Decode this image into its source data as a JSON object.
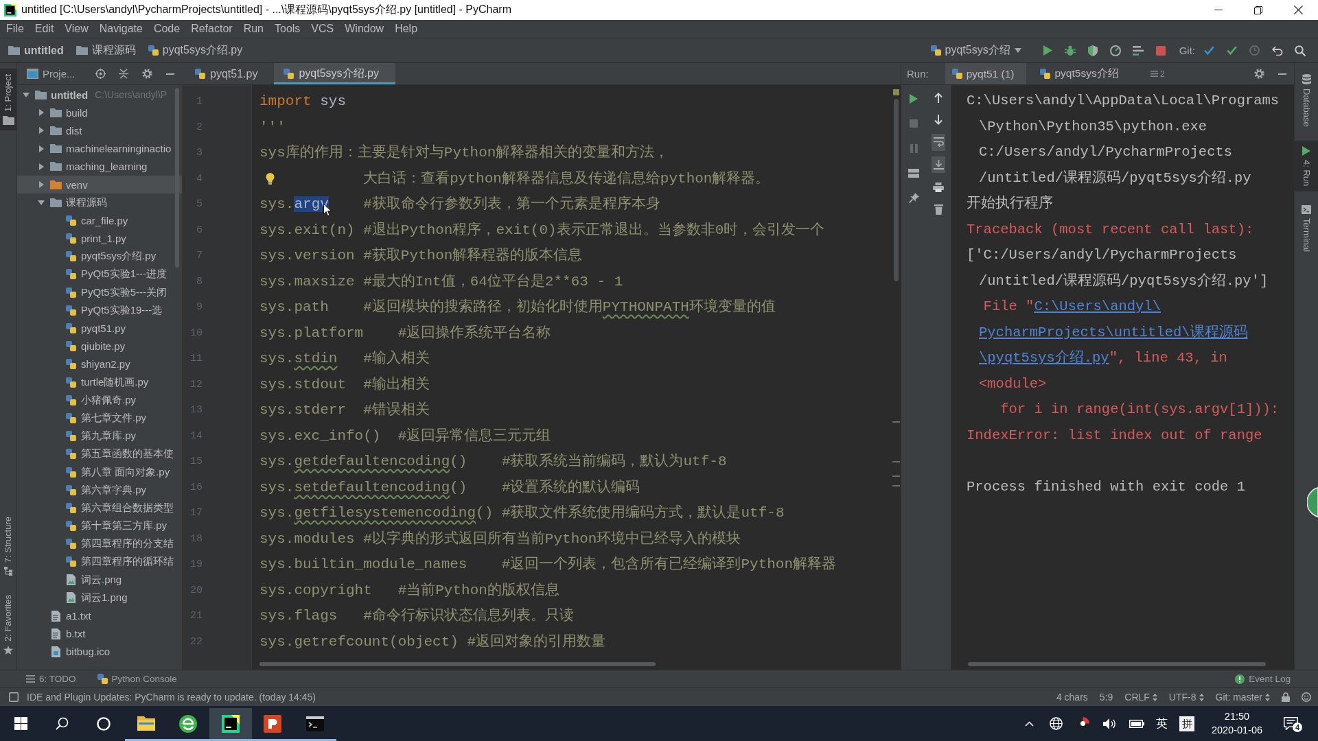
{
  "window": {
    "title": "untitled [C:\\Users\\andyl\\PycharmProjects\\untitled] - ...\\课程源码\\pyqt5sys介绍.py [untitled] - PyCharm"
  },
  "menu": [
    "File",
    "Edit",
    "View",
    "Navigate",
    "Code",
    "Refactor",
    "Run",
    "Tools",
    "VCS",
    "Window",
    "Help"
  ],
  "navigation": {
    "breadcrumbs": [
      {
        "kind": "module",
        "label": "untitled"
      },
      {
        "kind": "folder",
        "label": "课程源码"
      },
      {
        "kind": "python",
        "label": "pyqt5sys介绍.py"
      }
    ],
    "run_config": "pyqt5sys介绍",
    "actions": [
      {
        "kind": "run",
        "disabled": false
      },
      {
        "kind": "debug",
        "disabled": false
      },
      {
        "kind": "coverage",
        "disabled": false
      },
      {
        "kind": "profile",
        "disabled": false
      },
      {
        "kind": "concurrency",
        "disabled": false
      },
      {
        "kind": "stop",
        "disabled": false
      }
    ],
    "vcs": {
      "label": "Git:",
      "actions": [
        {
          "kind": "update",
          "disabled": false
        },
        {
          "kind": "commit",
          "disabled": false
        },
        {
          "kind": "history",
          "disabled": true
        },
        {
          "kind": "revert",
          "disabled": false
        }
      ]
    }
  },
  "left_tool_strip": {
    "top": [
      {
        "kind": "project",
        "label": "1: Project",
        "selected": true
      }
    ],
    "bottom": [
      {
        "kind": "structure",
        "label": "7: Structure",
        "selected": false
      },
      {
        "kind": "favorites",
        "label": "2: Favorites",
        "selected": false
      }
    ]
  },
  "project_panel": {
    "title": "Proje...",
    "tree": [
      {
        "kind": "module",
        "name": "untitled",
        "path": "C:\\Users\\andyl\\P",
        "expanded": true,
        "selected": false,
        "children": [
          {
            "kind": "folder",
            "name": "build",
            "expanded": false,
            "selected": false
          },
          {
            "kind": "folder",
            "name": "dist",
            "expanded": false,
            "selected": false
          },
          {
            "kind": "folder",
            "name": "machinelearninginactio",
            "expanded": false,
            "selected": false
          },
          {
            "kind": "folder",
            "name": "maching_learning",
            "expanded": false,
            "selected": false
          },
          {
            "kind": "excluded",
            "name": "venv",
            "expanded": false,
            "selected": true
          },
          {
            "kind": "folder",
            "name": "课程源码",
            "expanded": true,
            "selected": false,
            "children": [
              {
                "kind": "python",
                "name": "car_file.py",
                "selected": false
              },
              {
                "kind": "python",
                "name": "print_1.py",
                "selected": false
              },
              {
                "kind": "python",
                "name": "pyqt5sys介绍.py",
                "selected": false
              },
              {
                "kind": "python",
                "name": "PyQt5实验1---进度",
                "selected": false
              },
              {
                "kind": "python",
                "name": "PyQt5实验5---关闭",
                "selected": false
              },
              {
                "kind": "python",
                "name": "PyQt5实验19---选",
                "selected": false
              },
              {
                "kind": "python",
                "name": "pyqt51.py",
                "selected": false
              },
              {
                "kind": "python",
                "name": "qiubite.py",
                "selected": false
              },
              {
                "kind": "python",
                "name": "shiyan2.py",
                "selected": false
              },
              {
                "kind": "python",
                "name": "turtle随机画.py",
                "selected": false
              },
              {
                "kind": "python",
                "name": "小猪佩奇.py",
                "selected": false
              },
              {
                "kind": "python",
                "name": "第七章文件.py",
                "selected": false
              },
              {
                "kind": "python",
                "name": "第九章库.py",
                "selected": false
              },
              {
                "kind": "python",
                "name": "第五章函数的基本使",
                "selected": false
              },
              {
                "kind": "python",
                "name": "第八章 面向对象.py",
                "selected": false
              },
              {
                "kind": "python",
                "name": "第六章字典.py",
                "selected": false
              },
              {
                "kind": "python",
                "name": "第六章组合数据类型",
                "selected": false
              },
              {
                "kind": "python",
                "name": "第十章第三方库.py",
                "selected": false
              },
              {
                "kind": "python",
                "name": "第四章程序的分支结",
                "selected": false
              },
              {
                "kind": "python",
                "name": "第四章程序的循环结",
                "selected": false
              },
              {
                "kind": "image",
                "name": "词云.png",
                "selected": false
              },
              {
                "kind": "image",
                "name": "词云1.png",
                "selected": false
              }
            ]
          },
          {
            "kind": "text",
            "name": "a1.txt",
            "selected": false
          },
          {
            "kind": "text",
            "name": "b.txt",
            "selected": false
          },
          {
            "kind": "icon",
            "name": "bitbug.ico",
            "selected": false
          }
        ]
      }
    ]
  },
  "editor": {
    "tabs": [
      {
        "label": "pyqt51.py",
        "selected": false
      },
      {
        "label": "pyqt5sys介绍.py",
        "selected": true
      }
    ],
    "lines": [
      {
        "number": "1",
        "segments": [
          {
            "kind": "keyword",
            "text": "import"
          },
          {
            "kind": "name",
            "text": " sys"
          }
        ]
      },
      {
        "number": "2",
        "segments": [
          {
            "kind": "doc",
            "text": "'''"
          }
        ]
      },
      {
        "number": "3",
        "segments": [
          {
            "kind": "doc",
            "text": "sys库的作用：主要是针对与Python解释器相关的变量和方法，"
          }
        ]
      },
      {
        "number": "4",
        "bulb": true,
        "segments": [
          {
            "kind": "doc",
            "text": "            大白话：查看python解释器信息及传递信息给python解释器。"
          }
        ]
      },
      {
        "number": "5",
        "segments": [
          {
            "kind": "doc",
            "text": "sys."
          },
          {
            "kind": "selection",
            "text": "argv"
          },
          {
            "kind": "doc",
            "text": "    #获取命令行参数列表，第一个元素是程序本身"
          }
        ]
      },
      {
        "number": "6",
        "segments": [
          {
            "kind": "doc",
            "text": "sys.exit(n) #退出Python程序，exit(0)表示正常退出。当参数非0时，会引发一个"
          }
        ]
      },
      {
        "number": "7",
        "segments": [
          {
            "kind": "doc",
            "text": "sys.version #获取Python解释程器的版本信息"
          }
        ]
      },
      {
        "number": "8",
        "segments": [
          {
            "kind": "doc",
            "text": "sys.maxsize #最大的Int值，64位平台是2**63 - 1"
          }
        ]
      },
      {
        "number": "9",
        "segments": [
          {
            "kind": "doc",
            "text": "sys.path    #返回模块的搜索路径，初始化时使用"
          },
          {
            "kind": "typo",
            "text": "PYTHONPATH"
          },
          {
            "kind": "doc",
            "text": "环境变量的值"
          }
        ]
      },
      {
        "number": "10",
        "segments": [
          {
            "kind": "doc",
            "text": "sys.platform    #返回操作系统平台名称"
          }
        ]
      },
      {
        "number": "11",
        "segments": [
          {
            "kind": "doc",
            "text": "sys."
          },
          {
            "kind": "typo",
            "text": "stdin"
          },
          {
            "kind": "doc",
            "text": "   #输入相关"
          }
        ]
      },
      {
        "number": "12",
        "segments": [
          {
            "kind": "doc",
            "text": "sys.stdout  #输出相关"
          }
        ]
      },
      {
        "number": "13",
        "segments": [
          {
            "kind": "doc",
            "text": "sys.stderr  #错误相关"
          }
        ]
      },
      {
        "number": "14",
        "segments": [
          {
            "kind": "doc",
            "text": "sys.exc_info()  #返回异常信息三元元组"
          }
        ]
      },
      {
        "number": "15",
        "segments": [
          {
            "kind": "doc",
            "text": "sys."
          },
          {
            "kind": "typo",
            "text": "getdefaultencoding"
          },
          {
            "kind": "doc",
            "text": "()    #获取系统当前编码，默认为utf-8"
          }
        ]
      },
      {
        "number": "16",
        "segments": [
          {
            "kind": "doc",
            "text": "sys."
          },
          {
            "kind": "typo",
            "text": "setdefaultencoding"
          },
          {
            "kind": "doc",
            "text": "()    #设置系统的默认编码"
          }
        ]
      },
      {
        "number": "17",
        "segments": [
          {
            "kind": "doc",
            "text": "sys."
          },
          {
            "kind": "typo",
            "text": "getfilesystemencoding"
          },
          {
            "kind": "doc",
            "text": "() #获取文件系统使用编码方式，默认是utf-8"
          }
        ]
      },
      {
        "number": "18",
        "segments": [
          {
            "kind": "doc",
            "text": "sys.modules #以字典的形式返回所有当前Python环境中已经导入的模块"
          }
        ]
      },
      {
        "number": "19",
        "segments": [
          {
            "kind": "doc",
            "text": "sys.builtin_module_names    #返回一个列表，包含所有已经编译到Python解释器"
          }
        ]
      },
      {
        "number": "20",
        "segments": [
          {
            "kind": "doc",
            "text": "sys.copyright   #当前Python的版权信息"
          }
        ]
      },
      {
        "number": "21",
        "segments": [
          {
            "kind": "doc",
            "text": "sys.flags   #命令行标识状态信息列表。只读"
          }
        ]
      },
      {
        "number": "22",
        "segments": [
          {
            "kind": "doc",
            "text": "sys.getrefcount(object) #返回对象的引用数量"
          }
        ]
      }
    ]
  },
  "run_panel": {
    "label": "Run:",
    "tabs": [
      {
        "label": "pyqt51 (1)",
        "selected": true
      },
      {
        "label": "pyqt5sys介绍",
        "selected": false
      }
    ],
    "hidden_tabs": "2",
    "tool_columns": [
      {
        "tools": [
          {
            "kind": "rerun",
            "disabled": false
          },
          {
            "kind": "stop",
            "disabled": true
          },
          {
            "kind": "pause",
            "disabled": true
          },
          {
            "kind": "layout",
            "disabled": false
          },
          {
            "kind": "pin",
            "disabled": false
          }
        ]
      },
      {
        "tools": [
          {
            "kind": "up",
            "disabled": false
          },
          {
            "kind": "down",
            "disabled": false
          },
          {
            "kind": "wrap",
            "disabled": false,
            "on": true
          },
          {
            "kind": "scroll_end",
            "disabled": false,
            "on": true
          },
          {
            "kind": "print",
            "disabled": false
          },
          {
            "kind": "trash",
            "disabled": false
          }
        ]
      }
    ],
    "output": [
      {
        "kind": "line",
        "segments": [
          {
            "kind": "plain",
            "text": "C:\\Users\\andyl\\AppData\\Local\\Programs"
          }
        ]
      },
      {
        "kind": "wrap",
        "segments": [
          {
            "kind": "plain",
            "text": "\\Python\\Python35\\python.exe"
          }
        ]
      },
      {
        "kind": "wrap",
        "segments": [
          {
            "kind": "plain",
            "text": "C:/Users/andyl/PycharmProjects"
          }
        ]
      },
      {
        "kind": "wrap",
        "segments": [
          {
            "kind": "plain",
            "text": "/untitled/课程源码/pyqt5sys介绍.py"
          }
        ]
      },
      {
        "kind": "line",
        "segments": [
          {
            "kind": "plain",
            "text": "开始执行程序"
          }
        ]
      },
      {
        "kind": "line",
        "segments": [
          {
            "kind": "error",
            "text": "Traceback (most recent call last):"
          }
        ]
      },
      {
        "kind": "line",
        "segments": [
          {
            "kind": "plain",
            "text": "['C:/Users/andyl/PycharmProjects"
          }
        ]
      },
      {
        "kind": "wrap",
        "segments": [
          {
            "kind": "plain",
            "text": "/untitled/课程源码/pyqt5sys介绍.py']"
          }
        ]
      },
      {
        "kind": "line",
        "segments": [
          {
            "kind": "error",
            "text": "  File \""
          },
          {
            "kind": "link",
            "text": "C:\\Users\\andyl\\"
          }
        ]
      },
      {
        "kind": "wrap",
        "segments": [
          {
            "kind": "link",
            "text": "PycharmProjects\\untitled\\课程源码"
          }
        ]
      },
      {
        "kind": "wrap",
        "segments": [
          {
            "kind": "link",
            "text": "\\pyqt5sys介绍.py"
          },
          {
            "kind": "error",
            "text": "\", line 43, in"
          }
        ]
      },
      {
        "kind": "wrap",
        "segments": [
          {
            "kind": "error",
            "text": "<module>"
          }
        ]
      },
      {
        "kind": "line",
        "segments": [
          {
            "kind": "error",
            "text": "    for i in range(int(sys.argv[1])):"
          }
        ]
      },
      {
        "kind": "line",
        "segments": [
          {
            "kind": "error",
            "text": "IndexError: list index out of range"
          }
        ]
      },
      {
        "kind": "exit",
        "segments": [
          {
            "kind": "plain",
            "text": "Process finished with exit code 1"
          }
        ]
      }
    ]
  },
  "right_tool_strip": [
    {
      "kind": "database",
      "label": "Database",
      "selected": false
    },
    {
      "kind": "run",
      "label": "4: Run",
      "selected": true
    },
    {
      "kind": "terminal",
      "label": "Terminal",
      "selected": false
    }
  ],
  "bottom_tool_strip": {
    "left": [
      {
        "kind": "todo",
        "label": "6: TODO"
      },
      {
        "kind": "console",
        "label": "Python Console"
      }
    ],
    "right": [
      {
        "kind": "log",
        "label": "Event Log"
      }
    ]
  },
  "status_bar": {
    "message": "IDE and Plugin Updates: PyCharm is ready to update. (today 14:45)",
    "items": [
      {
        "kind": "info",
        "label": "4 chars"
      },
      {
        "kind": "action",
        "label": "5:9"
      },
      {
        "kind": "menu",
        "label": "CRLF"
      },
      {
        "kind": "menu",
        "label": "UTF-8"
      },
      {
        "kind": "menu",
        "label": "Git: master"
      }
    ]
  },
  "taskbar": {
    "apps": [
      {
        "kind": "explorer",
        "active": false,
        "running": true
      },
      {
        "kind": "browser",
        "active": false,
        "running": true
      },
      {
        "kind": "pycharm",
        "active": true,
        "running": true
      },
      {
        "kind": "powerpoint",
        "active": false,
        "running": true
      },
      {
        "kind": "terminal",
        "active": false,
        "running": true
      }
    ],
    "input_method": "英",
    "input_mode": "拼",
    "time": "21:50",
    "date": "2020-01-06",
    "notifications": "4"
  }
}
